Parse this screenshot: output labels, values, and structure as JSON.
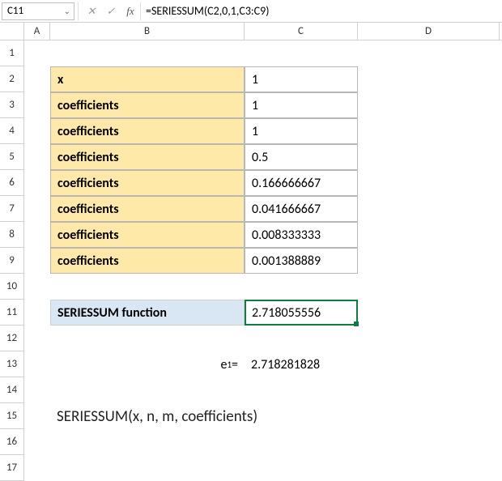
{
  "nameBox": "C11",
  "formula": "=SERIESSUM(C2,0,1,C3:C9)",
  "columns": {
    "A": "A",
    "B": "B",
    "C": "C",
    "D": "D"
  },
  "rows": {
    "r1": "1",
    "r2": "2",
    "r3": "3",
    "r4": "4",
    "r5": "5",
    "r6": "6",
    "r7": "7",
    "r8": "8",
    "r9": "9",
    "r10": "10",
    "r11": "11",
    "r12": "12",
    "r13": "13",
    "r14": "14",
    "r15": "15",
    "r16": "16",
    "r17": "17"
  },
  "cells": {
    "b2": "x",
    "c2": "1",
    "b3": "coefficients",
    "c3": "1",
    "b4": "coefficients",
    "c4": "1",
    "b5": "coefficients",
    "c5": "0.5",
    "b6": "coefficients",
    "c6": "0.166666667",
    "b7": "coefficients",
    "c7": "0.041666667",
    "b8": "coefficients",
    "c8": "0.008333333",
    "b9": "coefficients",
    "c9": "0.001388889",
    "b11": "SERIESSUM function",
    "c11": "2.718055556",
    "b13_prefix": "e",
    "b13_exp": "1",
    "b13_suffix": " =",
    "c13": "2.718281828",
    "b15": "SERIESSUM(x, n, m, coefficients)"
  },
  "icons": {
    "cancel": "✕",
    "enter": "✓",
    "fx": "fx",
    "chevron": "⌄"
  },
  "chart_data": {
    "type": "table",
    "title": "SERIESSUM function",
    "labels": [
      "x",
      "coefficients",
      "coefficients",
      "coefficients",
      "coefficients",
      "coefficients",
      "coefficients",
      "coefficients"
    ],
    "values": [
      1,
      1,
      1,
      0.5,
      0.166666667,
      0.041666667,
      0.008333333,
      0.001388889
    ],
    "result": 2.718055556,
    "reference": {
      "label": "e^1",
      "value": 2.718281828
    },
    "syntax": "SERIESSUM(x, n, m, coefficients)"
  }
}
